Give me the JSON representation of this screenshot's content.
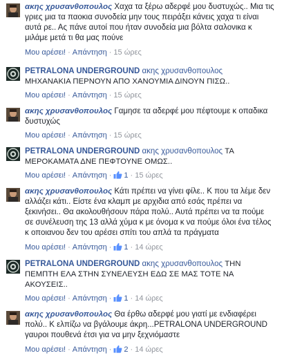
{
  "comments": [
    {
      "author": "ακης χρυσανθοπουλος",
      "lines": [
        "Χαχα τα ξέρω αδερφέ μου δυστυχώς.. Μια τις",
        "γριες μια τα παοκια συνοδεία μην τους πειράξει κάνεις χαχα τι είναι",
        "αυτά ρε.. Ας πάνε αυτοί που ήταν συνοδεία μια βόλτα σαλονικα κ",
        "μιλάμε μετά τι θα μας πούνε"
      ],
      "like": "Μου αρέσει!",
      "reply": "Απάντηση",
      "time": "15 ώρες",
      "likes": ""
    },
    {
      "author": "PETRALONA UNDERGROUND",
      "mention": "ακης χρυσανθοπουλος",
      "lines": [
        "ΜΗΧΑΝΑΚΙΑ ΠΕΡΝΟΥΝ ΑΠΟ ΧΑΝΟΥΜΙΑ ΔΙΝΟΥΝ ΠΙΣΩ.."
      ],
      "like": "Μου αρέσει!",
      "reply": "Απάντηση",
      "time": "15 ώρες",
      "likes": ""
    },
    {
      "author": "ακης χρυσανθοπουλος",
      "lines": [
        "Γαμησε τα αδερφέ μου πέφτουμε κ οπαδικα",
        "δυστυχώς"
      ],
      "like": "Μου αρέσει!",
      "reply": "Απάντηση",
      "time": "15 ώρες",
      "likes": ""
    },
    {
      "author": "PETRALONA UNDERGROUND",
      "mention": "ακης χρυσανθοπουλος",
      "lines": [
        "ΤΑ",
        "ΜΕΡΟΚΑΜΑΤΑ ΔΝΕ ΠΕΦΤΟΥΝΕ ΟΜΩΣ.."
      ],
      "like": "Μου αρέσει!",
      "reply": "Απάντηση",
      "time": "15 ώρες",
      "likes": "1"
    },
    {
      "author": "ακης χρυσανθοπουλος",
      "lines": [
        "Κάτι πρέπει να γίνει φίλε.. Κ που τα λέμε δεν",
        "αλλάζει κάτι.. Είστε ένα κλαμπ με αρχιδια από εσάς πρέπει να",
        "ξεκινήσει.. Θα ακολουθήσουν πάρα πολύ.. Αυτά πρέπει να τα πούμε",
        "σε συνέλευση της 13 αλλά χύμα κ με όνομα κ να πούμε όλοι ένα τέλος",
        "κ οποιανου δεν του αρέσει σπίτι του απλά τα πράγματα"
      ],
      "like": "Μου αρέσει!",
      "reply": "Απάντηση",
      "time": "14 ώρες",
      "likes": "1"
    },
    {
      "author": "PETRALONA UNDERGROUND",
      "mention": "ακης χρυσανθοπουλος",
      "lines": [
        "ΤΗΝ",
        "ΠΕΜΠΤΗ ΕΛΑ ΣΤΗΝ ΣΥΝΕΛΕΥΣΗ ΕΔΩ ΣΕ ΜΑΣ ΤΟΤΕ ΝΑ",
        "ΑΚΟΥΣΕΙΣ.."
      ],
      "like": "Μου αρέσει!",
      "reply": "Απάντηση",
      "time": "14 ώρες",
      "likes": "1"
    },
    {
      "author": "ακης χρυσανθοπουλος",
      "lines": [
        "Θα έρθω αδερφέ μου γιατί με ενδιαφέρει",
        "πολύ.. Κ ελπίζω να βγάλουμε άκρη...PETRALONA UNDERGROUND",
        "γαυροι πουθενά έτσι για να μην ξεχνιόμαστε"
      ],
      "like": "Μου αρέσει!",
      "reply": "Απάντηση",
      "time": "14 ώρες",
      "likes": "2"
    }
  ]
}
